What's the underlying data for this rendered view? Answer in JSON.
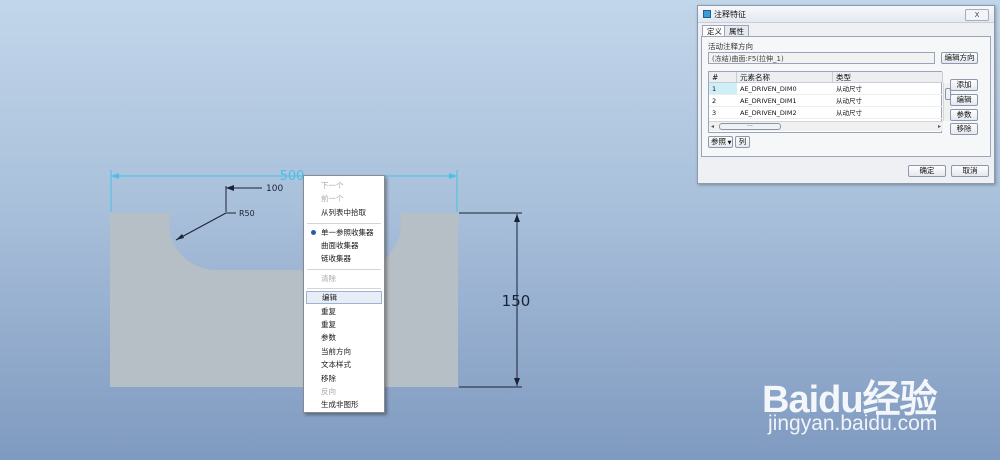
{
  "drawing": {
    "dim_width": "500",
    "dim_depth": "100",
    "dim_radius": "R50",
    "dim_height": "150"
  },
  "context_menu": {
    "items": [
      {
        "label": "下一个",
        "state": "disabled"
      },
      {
        "label": "前一个",
        "state": "disabled"
      },
      {
        "label": "从列表中拾取",
        "state": "enabled"
      },
      {
        "label": "单一参照收集器",
        "state": "selected"
      },
      {
        "label": "曲面收集器",
        "state": "enabled"
      },
      {
        "label": "链收集器",
        "state": "enabled"
      },
      {
        "label": "清除",
        "state": "disabled"
      },
      {
        "label": "编辑",
        "state": "highlighted"
      },
      {
        "label": "重复",
        "state": "enabled"
      },
      {
        "label": "重复",
        "state": "enabled"
      },
      {
        "label": "参数",
        "state": "enabled"
      },
      {
        "label": "当前方向",
        "state": "enabled"
      },
      {
        "label": "文本样式",
        "state": "enabled"
      },
      {
        "label": "移除",
        "state": "enabled"
      },
      {
        "label": "反向",
        "state": "disabled"
      },
      {
        "label": "生成非图形",
        "state": "enabled"
      }
    ]
  },
  "dialog": {
    "title": "注释特征",
    "tabs": [
      "定义",
      "属性"
    ],
    "active_tab": "定义",
    "direction_label": "活动注释方向",
    "direction_value": "(冻结)曲面:F5(拉伸_1)",
    "edit_direction_button": "编辑方向",
    "table": {
      "headers": [
        "#",
        "元素名称",
        "类型"
      ],
      "rows": [
        [
          "1",
          "AE_DRIVEN_DIM0",
          "从动尺寸"
        ],
        [
          "2",
          "AE_DRIVEN_DIM1",
          "从动尺寸"
        ],
        [
          "3",
          "AE_DRIVEN_DIM2",
          "从动尺寸"
        ]
      ],
      "scroll_thumb": "---"
    },
    "side_buttons": [
      "添加",
      "编辑",
      "参数",
      "移除"
    ],
    "reference_button": "参照",
    "column_button": "列",
    "ok_button": "确定",
    "cancel_button": "取消",
    "close_glyph": "X"
  },
  "watermark": {
    "logo": "Baidu经验",
    "url": "jingyan.baidu.com"
  },
  "colors": {
    "part_fill": "#b6bfc5",
    "dim_cyan": "#4dbfe6",
    "dim_dark": "#1a2238"
  }
}
